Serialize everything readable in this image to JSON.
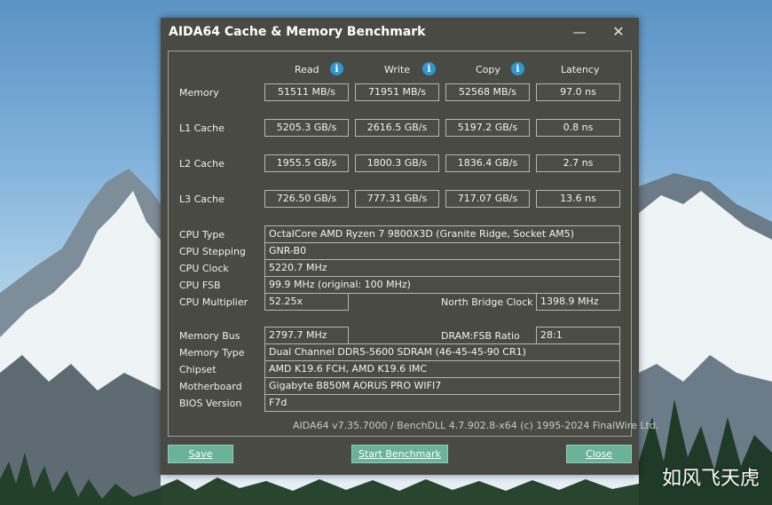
{
  "window": {
    "title": "AIDA64 Cache & Memory Benchmark"
  },
  "columns": {
    "read": "Read",
    "write": "Write",
    "copy": "Copy",
    "latency": "Latency"
  },
  "info_icon": "info-icon",
  "bench_rows": [
    {
      "label": "Memory",
      "read": "51511 MB/s",
      "write": "71951 MB/s",
      "copy": "52568 MB/s",
      "latency": "97.0 ns"
    },
    {
      "label": "L1 Cache",
      "read": "5205.3 GB/s",
      "write": "2616.5 GB/s",
      "copy": "5197.2 GB/s",
      "latency": "0.8 ns"
    },
    {
      "label": "L2 Cache",
      "read": "1955.5 GB/s",
      "write": "1800.3 GB/s",
      "copy": "1836.4 GB/s",
      "latency": "2.7 ns"
    },
    {
      "label": "L3 Cache",
      "read": "726.50 GB/s",
      "write": "777.31 GB/s",
      "copy": "717.07 GB/s",
      "latency": "13.6 ns"
    }
  ],
  "cpu": {
    "type_label": "CPU Type",
    "type_value": "OctalCore AMD Ryzen 7 9800X3D  (Granite Ridge, Socket AM5)",
    "stepping_label": "CPU Stepping",
    "stepping_value": "GNR-B0",
    "clock_label": "CPU Clock",
    "clock_value": "5220.7 MHz",
    "fsb_label": "CPU FSB",
    "fsb_value": "99.9 MHz  (original: 100 MHz)",
    "multiplier_label": "CPU Multiplier",
    "multiplier_value": "52.25x",
    "nb_clock_label": "North Bridge Clock",
    "nb_clock_value": "1398.9 MHz"
  },
  "memory": {
    "bus_label": "Memory Bus",
    "bus_value": "2797.7 MHz",
    "ratio_label": "DRAM:FSB Ratio",
    "ratio_value": "28:1",
    "type_label": "Memory Type",
    "type_value": "Dual Channel DDR5-5600 SDRAM  (46-45-45-90 CR1)",
    "chipset_label": "Chipset",
    "chipset_value": "AMD K19.6 FCH, AMD K19.6 IMC",
    "motherboard_label": "Motherboard",
    "motherboard_value": "Gigabyte B850M AORUS PRO WIFI7",
    "bios_label": "BIOS Version",
    "bios_value": "F7d"
  },
  "footer": "AIDA64 v7.35.7000 / BenchDLL 4.7.902.8-x64  (c) 1995-2024 FinalWire Ltd.",
  "buttons": {
    "save": "Save",
    "start": "Start Benchmark",
    "close": "Close"
  },
  "watermark": "如风飞天虎",
  "colors": {
    "window_bg": "#484a43",
    "button_bg": "#6ab29a",
    "info_blue": "#2f97d0"
  }
}
